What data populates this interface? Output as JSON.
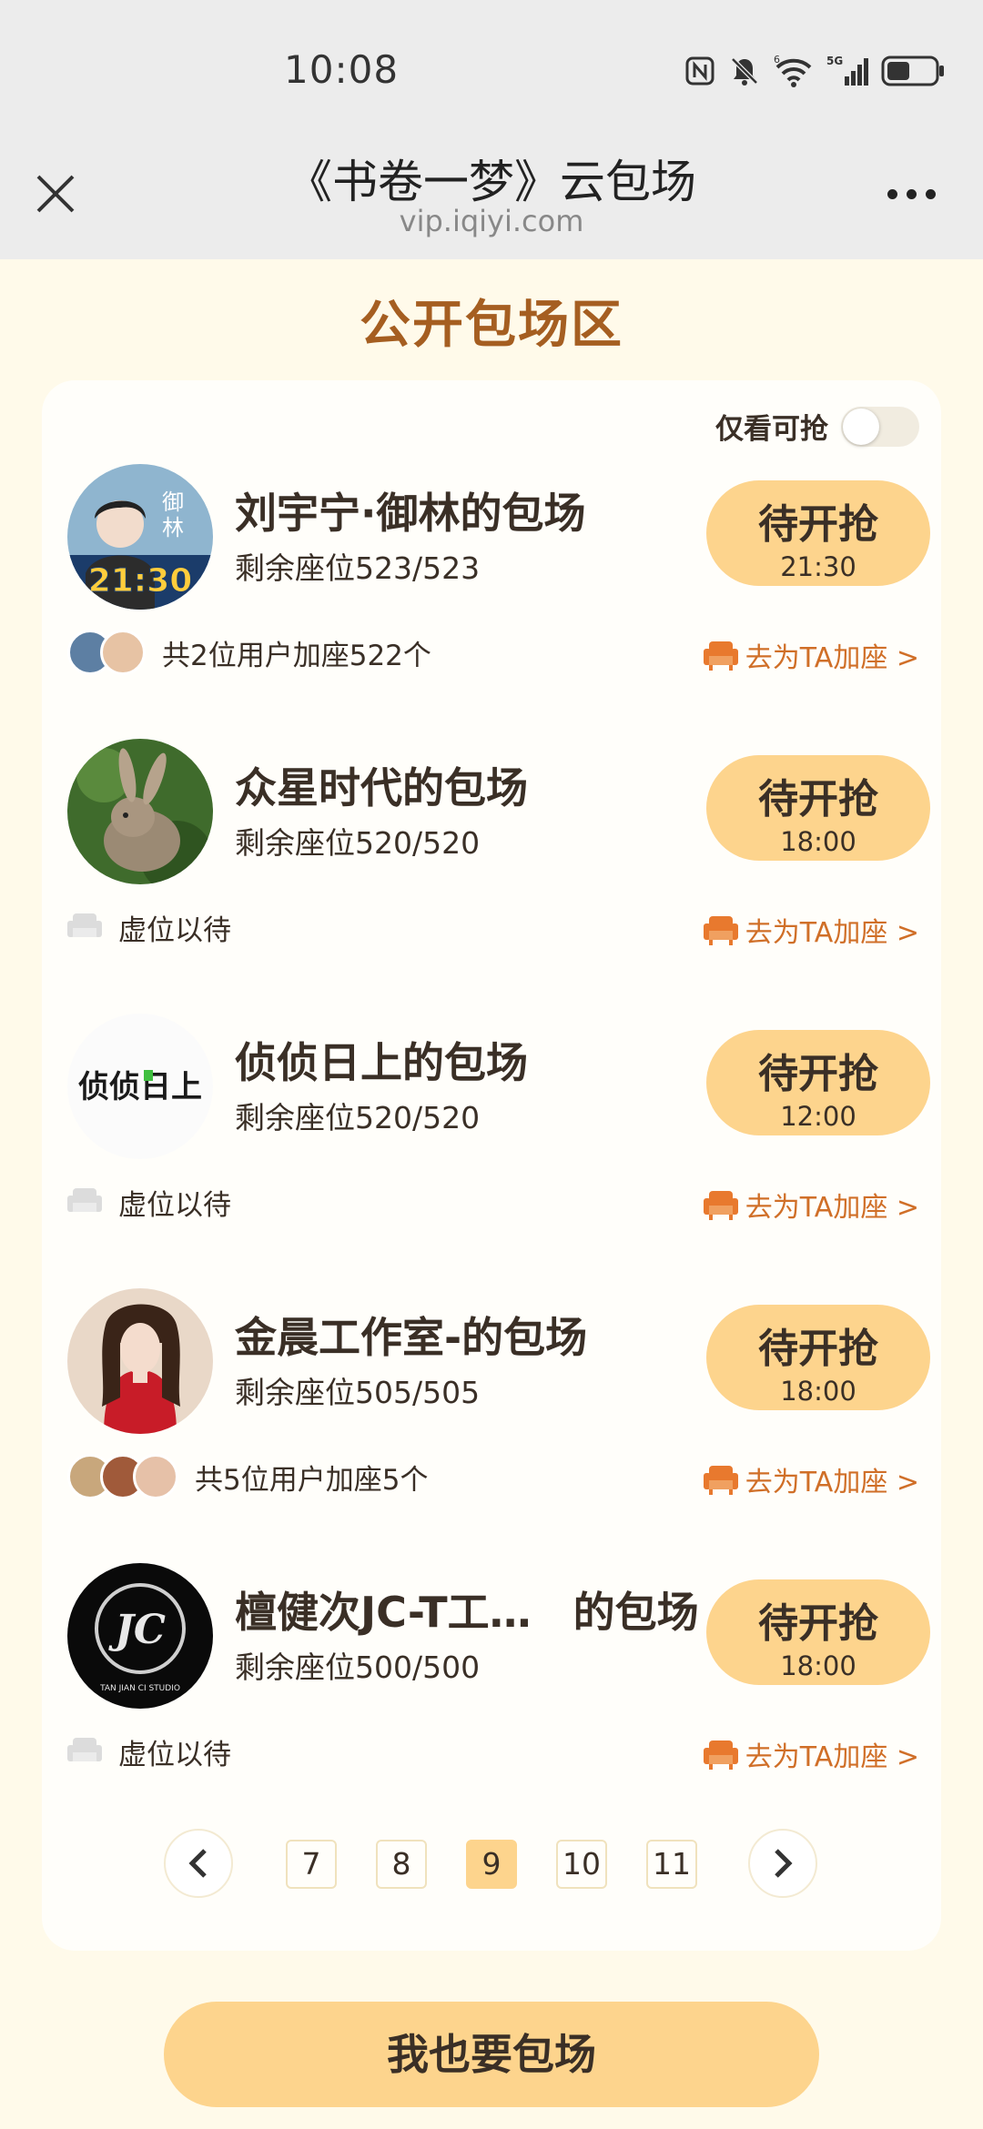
{
  "status_bar": {
    "time": "10:08",
    "network": "5G",
    "wifi_label": "6"
  },
  "header": {
    "title": "《书卷一梦》云包场",
    "url": "vip.iqiyi.com"
  },
  "section_title": "公开包场区",
  "filter": {
    "label": "仅看可抢",
    "enabled": false
  },
  "sessions": [
    {
      "title": "刘宇宁·御林的包场",
      "seats": "剩余座位523/523",
      "button_label": "待开抢",
      "button_time": "21:30",
      "footer_text": "共2位用户加座522个",
      "avatar_text": "御林",
      "avatar_badge": "21:30",
      "link": "去为TA加座 >"
    },
    {
      "title": "众星时代的包场",
      "seats": "剩余座位520/520",
      "button_label": "待开抢",
      "button_time": "18:00",
      "footer_text": "虚位以待",
      "link": "去为TA加座 >"
    },
    {
      "title": "侦侦日上的包场",
      "seats": "剩余座位520/520",
      "button_label": "待开抢",
      "button_time": "12:00",
      "footer_text": "虚位以待",
      "avatar_text": "侦侦日上",
      "link": "去为TA加座 >"
    },
    {
      "title": "金晨工作室-的包场",
      "seats": "剩余座位505/505",
      "button_label": "待开抢",
      "button_time": "18:00",
      "footer_text": "共5位用户加座5个",
      "link": "去为TA加座 >"
    },
    {
      "title": "檀健次JC-T工…　的包场",
      "seats": "剩余座位500/500",
      "button_label": "待开抢",
      "button_time": "18:00",
      "footer_text": "虚位以待",
      "avatar_text": "TAN JIAN CI STUDIO",
      "link": "去为TA加座 >"
    }
  ],
  "pagination": {
    "pages": [
      "7",
      "8",
      "9",
      "10",
      "11"
    ],
    "current": "9"
  },
  "cta_label": "我也要包场",
  "colors": {
    "accent": "#fdd48d",
    "title_brown": "#a55e21",
    "link_orange": "#d06f28"
  }
}
